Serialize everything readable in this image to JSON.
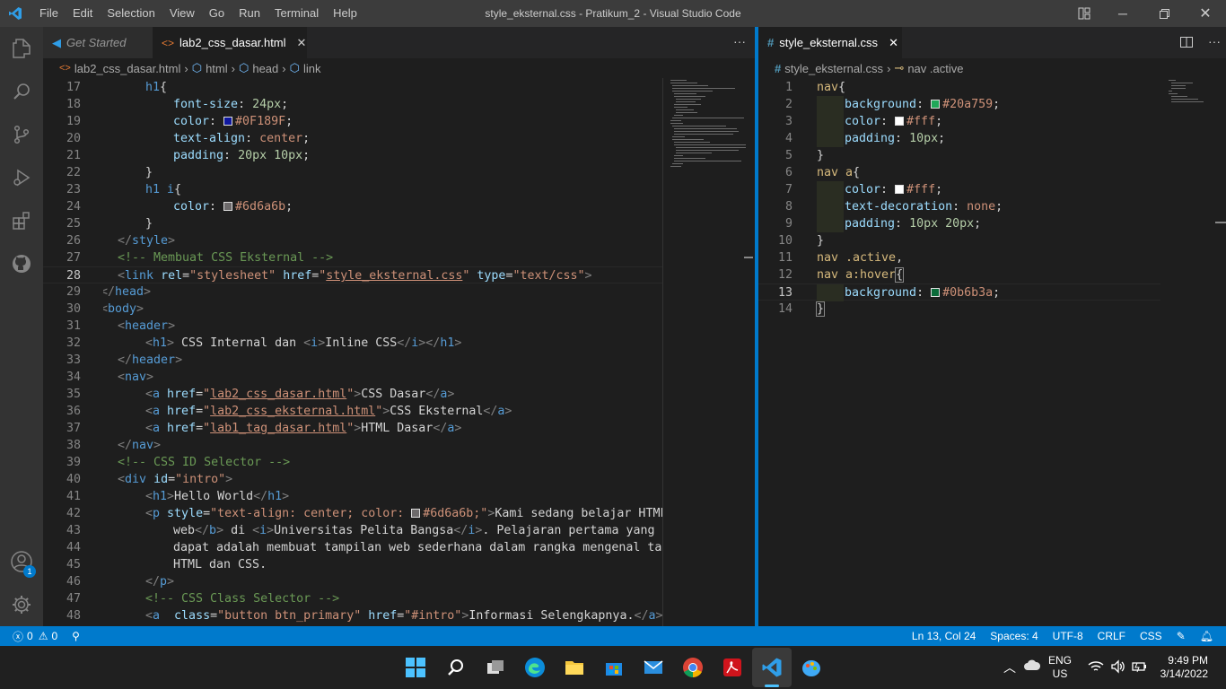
{
  "menu": [
    "File",
    "Edit",
    "Selection",
    "View",
    "Go",
    "Run",
    "Terminal",
    "Help"
  ],
  "window_title": "style_eksternal.css - Pratikum_2 - Visual Studio Code",
  "left_editor": {
    "tabs": [
      {
        "label": "Get Started",
        "active": false
      },
      {
        "label": "lab2_css_dasar.html",
        "active": true
      }
    ],
    "breadcrumb": [
      "lab2_css_dasar.html",
      "html",
      "head",
      "link"
    ],
    "lines": [
      {
        "n": "17",
        "html": "<span class='t'>h1</span><span class='w'>{</span>",
        "indent": 2
      },
      {
        "n": "18",
        "html": "<span class='pr'>font-size</span><span class='w'>: </span><span class='n'>24px</span><span class='w'>;</span>",
        "indent": 3
      },
      {
        "n": "19",
        "html": "<span class='pr'>color</span><span class='w'>: </span><span class='sw' style='background:#0F189F'></span><span class='v'>#0F189F</span><span class='w'>;</span>",
        "indent": 3
      },
      {
        "n": "20",
        "html": "<span class='pr'>text-align</span><span class='w'>: </span><span class='v'>center</span><span class='w'>;</span>",
        "indent": 3
      },
      {
        "n": "21",
        "html": "<span class='pr'>padding</span><span class='w'>: </span><span class='n'>20px 10px</span><span class='w'>;</span>",
        "indent": 3
      },
      {
        "n": "22",
        "html": "<span class='w'>}</span>",
        "indent": 2
      },
      {
        "n": "23",
        "html": "<span class='t'>h1 i</span><span class='w'>{</span>",
        "indent": 2
      },
      {
        "n": "24",
        "html": "<span class='pr'>color</span><span class='w'>: </span><span class='sw' style='background:#6d6a6b'></span><span class='v'>#6d6a6b</span><span class='w'>;</span>",
        "indent": 3
      },
      {
        "n": "25",
        "html": "<span class='w'>}</span>",
        "indent": 2
      },
      {
        "n": "26",
        "html": "<span class='p'>&lt;/</span><span class='t'>style</span><span class='p'>&gt;</span>",
        "indent": 1
      },
      {
        "n": "27",
        "html": "<span class='c'>&lt;!-- Membuat CSS Eksternal --&gt;</span>",
        "indent": 1
      },
      {
        "n": "28",
        "html": "<span class='p'>&lt;</span><span class='t'>link</span> <span class='a'>rel</span><span class='w'>=</span><span class='s'>\"stylesheet\"</span> <span class='a'>href</span><span class='w'>=</span><span class='s'>\"<u>style_eksternal.css</u>\"</span> <span class='a'>type</span><span class='w'>=</span><span class='s'>\"text/css\"</span><span class='p'>&gt;</span>",
        "indent": 1
      },
      {
        "n": "29",
        "html": "<span class='p'>&lt;/</span><span class='t'>head</span><span class='p'>&gt;</span>",
        "indent": 0
      },
      {
        "n": "30",
        "html": "<span class='p'>&lt;</span><span class='t'>body</span><span class='p'>&gt;</span>",
        "indent": 0
      },
      {
        "n": "31",
        "html": "<span class='p'>&lt;</span><span class='t'>header</span><span class='p'>&gt;</span>",
        "indent": 1
      },
      {
        "n": "32",
        "html": "<span class='p'>&lt;</span><span class='t'>h1</span><span class='p'>&gt;</span><span class='w'> CSS Internal dan </span><span class='p'>&lt;</span><span class='t'>i</span><span class='p'>&gt;</span><span class='w'>Inline CSS</span><span class='p'>&lt;/</span><span class='t'>i</span><span class='p'>&gt;&lt;/</span><span class='t'>h1</span><span class='p'>&gt;</span>",
        "indent": 2
      },
      {
        "n": "33",
        "html": "<span class='p'>&lt;/</span><span class='t'>header</span><span class='p'>&gt;</span>",
        "indent": 1
      },
      {
        "n": "34",
        "html": "<span class='p'>&lt;</span><span class='t'>nav</span><span class='p'>&gt;</span>",
        "indent": 1
      },
      {
        "n": "35",
        "html": "<span class='p'>&lt;</span><span class='t'>a</span> <span class='a'>href</span><span class='w'>=</span><span class='s'>\"<u>lab2_css_dasar.html</u>\"</span><span class='p'>&gt;</span><span class='w'>CSS Dasar</span><span class='p'>&lt;/</span><span class='t'>a</span><span class='p'>&gt;</span>",
        "indent": 2
      },
      {
        "n": "36",
        "html": "<span class='p'>&lt;</span><span class='t'>a</span> <span class='a'>href</span><span class='w'>=</span><span class='s'>\"<u>lab2_css_eksternal.html</u>\"</span><span class='p'>&gt;</span><span class='w'>CSS Eksternal</span><span class='p'>&lt;/</span><span class='t'>a</span><span class='p'>&gt;</span>",
        "indent": 2
      },
      {
        "n": "37",
        "html": "<span class='p'>&lt;</span><span class='t'>a</span> <span class='a'>href</span><span class='w'>=</span><span class='s'>\"<u>lab1_tag_dasar.html</u>\"</span><span class='p'>&gt;</span><span class='w'>HTML Dasar</span><span class='p'>&lt;/</span><span class='t'>a</span><span class='p'>&gt;</span>",
        "indent": 2
      },
      {
        "n": "38",
        "html": "<span class='p'>&lt;/</span><span class='t'>nav</span><span class='p'>&gt;</span>",
        "indent": 1
      },
      {
        "n": "39",
        "html": "<span class='c'>&lt;!-- CSS ID Selector --&gt;</span>",
        "indent": 1
      },
      {
        "n": "40",
        "html": "<span class='p'>&lt;</span><span class='t'>div</span> <span class='a'>id</span><span class='w'>=</span><span class='s'>\"intro\"</span><span class='p'>&gt;</span>",
        "indent": 1
      },
      {
        "n": "41",
        "html": "<span class='p'>&lt;</span><span class='t'>h1</span><span class='p'>&gt;</span><span class='w'>Hello World</span><span class='p'>&lt;/</span><span class='t'>h1</span><span class='p'>&gt;</span>",
        "indent": 2
      },
      {
        "n": "42",
        "html": "<span class='p'>&lt;</span><span class='t'>p</span> <span class='a'>style</span><span class='w'>=</span><span class='s'>\"text-align: center; color: </span><span class='sw' style='background:#6d6a6b'></span><span class='s'>#6d6a6b;\"</span><span class='p'>&gt;</span><span class='w'>Kami sedang belajar HTML d</span>",
        "indent": 2
      },
      {
        "n": "43",
        "html": "<span class='w'>web</span><span class='p'>&lt;/</span><span class='t'>b</span><span class='p'>&gt;</span><span class='w'> di </span><span class='p'>&lt;</span><span class='t'>i</span><span class='p'>&gt;</span><span class='w'>Universitas Pelita Bangsa</span><span class='p'>&lt;/</span><span class='t'>i</span><span class='p'>&gt;</span><span class='w'>. Pelajaran pertama yang kam</span>",
        "indent": 3
      },
      {
        "n": "44",
        "html": "<span class='w'>dapat adalah membuat tampilan web sederhana dalam rangka mengenal tag-t</span>",
        "indent": 3
      },
      {
        "n": "45",
        "html": "<span class='w'>HTML dan CSS.</span>",
        "indent": 3
      },
      {
        "n": "46",
        "html": "<span class='p'>&lt;/</span><span class='t'>p</span><span class='p'>&gt;</span>",
        "indent": 2
      },
      {
        "n": "47",
        "html": "<span class='c'>&lt;!-- CSS Class Selector --&gt;</span>",
        "indent": 2
      },
      {
        "n": "48",
        "html": "<span class='p'>&lt;</span><span class='t'>a</span>  <span class='a'>class</span><span class='w'>=</span><span class='s'>\"button btn_primary\"</span> <span class='a'>href</span><span class='w'>=</span><span class='s'>\"#intro\"</span><span class='p'>&gt;</span><span class='w'>Informasi Selengkapnya.</span><span class='p'>&lt;/</span><span class='t'>a</span><span class='p'>&gt;</span>",
        "indent": 2
      }
    ]
  },
  "right_editor": {
    "tab": "style_eksternal.css",
    "breadcrumb": [
      "style_eksternal.css",
      "nav .active"
    ],
    "lines": [
      {
        "n": "1",
        "html": "<span class='sel'>nav</span><span class='w'>{</span>",
        "indent": 0
      },
      {
        "n": "2",
        "html": "<span class='pr'>background</span><span class='w'>: </span><span class='sw' style='background:#20a759'></span><span class='v'>#20a759</span><span class='w'>;</span>",
        "indent": 1
      },
      {
        "n": "3",
        "html": "<span class='pr'>color</span><span class='w'>: </span><span class='sw' style='background:#fff'></span><span class='v'>#fff</span><span class='w'>;</span>",
        "indent": 1
      },
      {
        "n": "4",
        "html": "<span class='pr'>padding</span><span class='w'>: </span><span class='n'>10px</span><span class='w'>;</span>",
        "indent": 1
      },
      {
        "n": "5",
        "html": "<span class='w'>}</span>",
        "indent": 0
      },
      {
        "n": "6",
        "html": "<span class='sel'>nav a</span><span class='w'>{</span>",
        "indent": 0
      },
      {
        "n": "7",
        "html": "<span class='pr'>color</span><span class='w'>: </span><span class='sw' style='background:#fff'></span><span class='v'>#fff</span><span class='w'>;</span>",
        "indent": 1
      },
      {
        "n": "8",
        "html": "<span class='pr'>text-decoration</span><span class='w'>: </span><span class='v'>none</span><span class='w'>;</span>",
        "indent": 1
      },
      {
        "n": "9",
        "html": "<span class='pr'>padding</span><span class='w'>: </span><span class='n'>10px 20px</span><span class='w'>;</span>",
        "indent": 1
      },
      {
        "n": "10",
        "html": "<span class='w'>}</span>",
        "indent": 0
      },
      {
        "n": "11",
        "html": "<span class='sel'>nav .active</span><span class='w'>,</span>",
        "indent": 0
      },
      {
        "n": "12",
        "html": "<span class='sel'>nav a:hover</span><span class='w' style='outline:1px solid #888'>{</span>",
        "indent": 0
      },
      {
        "n": "13",
        "html": "<span class='pr'>background</span><span class='w'>: </span><span class='sw' style='background:#0b6b3a'></span><span class='v'>#0b6b3a</span><span class='w'>;</span>",
        "indent": 1
      },
      {
        "n": "14",
        "html": "<span class='w' style='outline:1px solid #888'>}</span>",
        "indent": 0
      }
    ]
  },
  "status": {
    "errors": "0",
    "warnings": "0",
    "position": "Ln 13, Col 24",
    "spaces": "Spaces: 4",
    "encoding": "UTF-8",
    "eol": "CRLF",
    "language": "CSS"
  },
  "taskbar": {
    "lang": "ENG",
    "region": "US",
    "time": "9:49 PM",
    "date": "3/14/2022"
  },
  "account_badge": "1"
}
